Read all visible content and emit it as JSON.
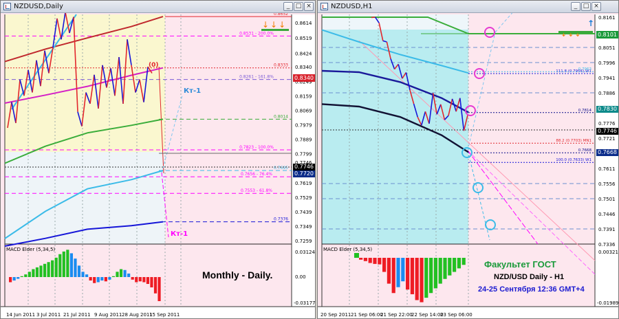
{
  "colors": {
    "mt_red": "#e2262c",
    "mt_blue": "#1515d8",
    "mt_green": "#3aad3a",
    "mt_cyan": "#3bbbe8",
    "mt_magenta": "#ff00ff"
  },
  "windows": [
    {
      "title": "NZDUSD,Daily",
      "buttons": [
        "_",
        "□",
        "×"
      ],
      "price_labels": [
        "0.8614",
        "0.8519",
        "0.8424",
        "0.8340",
        "0.8249",
        "0.8159",
        "0.8069",
        "0.7979",
        "0.7889",
        "0.7799",
        "0.7746",
        "0.7720",
        "0.7619",
        "0.7529",
        "0.7439",
        "0.7349",
        "0.7259"
      ],
      "current_price": "0.8340",
      "bid_box": "0.7746",
      "ask_box": "0.7720",
      "level_labels": [
        "0.8652",
        "0.8531 - 200.0%",
        "0.8333",
        "0.8261 - 161.8%",
        "0.8014",
        "0.7823 - 100.0%",
        "0.7695",
        "0.7656 - 76.4%",
        "0.7553 - 61.8%",
        "0.7376"
      ],
      "kt_labels": [
        "Кт-1",
        "Кт-1"
      ],
      "zero_marker": "(0)",
      "macd": {
        "title": "MACD Elder (5,34,5)",
        "labels": [
          "0.03124",
          "0.00",
          "-0.03177"
        ]
      },
      "time_labels": [
        "14 Jun 2011",
        "3 Jul 2011",
        "21 Jul 2011",
        "9 Aug 2011",
        "28 Aug 2011",
        "15 Sep 2011"
      ],
      "caption": "Monthly - Daily."
    },
    {
      "title": "NZDUSD,H1",
      "buttons": [
        "_",
        "□",
        "×"
      ],
      "price_labels": [
        "0.8161",
        "0.8101",
        "0.8051",
        "0.7996",
        "0.7941",
        "0.7886",
        "0.7830",
        "0.7776",
        "0.7746",
        "0.7721",
        "0.7668",
        "0.7611",
        "0.7556",
        "0.7501",
        "0.7446",
        "0.7391",
        "0.7336"
      ],
      "level_labels": [
        "111.8 (0.7956) W1",
        "0.7963",
        "0.7814",
        "88.2 (0.7703) MN1",
        "0.7668",
        "100.0 (0.7633) W1"
      ],
      "macd": {
        "title": "MACD Elder (5,34,5)",
        "labels": [
          "0.00321",
          "-0.01989"
        ]
      },
      "time_labels": [
        "20 Sep 2011",
        "21 Sep 06:00",
        "21 Sep 22:00",
        "22 Sep 14:00",
        "23 Sep 06:00"
      ],
      "caption_lines": [
        "Факультет ГОСТ",
        "NZD/USD Daily - H1",
        "24-25 Сентября 12:36 GMT+4"
      ]
    }
  ],
  "chart_data": [
    {
      "type": "line",
      "title": "NZDUSD,Daily",
      "series": [
        {
          "name": "",
          "values": [
            0.796,
            0.812,
            0.799,
            0.826,
            0.816,
            0.832,
            0.818,
            0.838,
            0.822,
            0.844,
            0.83,
            0.846,
            0.864,
            0.851,
            0.868,
            0.855,
            0.865,
            0.806,
            0.797,
            0.818,
            0.811,
            0.829,
            0.808,
            0.835,
            0.821,
            0.833,
            0.816,
            0.84,
            0.811,
            0.851,
            0.835,
            0.818,
            0.826,
            0.812,
            0.834,
            0.83
          ]
        },
        {
          "name": "",
          "values": [
            0.7225,
            0.7273,
            0.733,
            0.7352,
            0.7376
          ]
        },
        {
          "name": "",
          "values": [
            0.7272,
            0.7441,
            0.7581,
            0.7638,
            0.7695
          ]
        },
        {
          "name": "",
          "values": [
            0.774,
            0.7846,
            0.7929,
            0.7976,
            0.8014
          ]
        },
        {
          "name": "",
          "values": [
            0.8114,
            0.8164,
            0.8218,
            0.8287,
            0.8333
          ]
        },
        {
          "name": "",
          "values": [
            0.8372,
            0.845,
            0.8519,
            0.859,
            0.8652
          ]
        }
      ],
      "levels": [
        0.8652,
        0.8531,
        0.8333,
        0.8261,
        0.8014,
        0.7823,
        0.7695,
        0.7656,
        0.7553,
        0.7376
      ],
      "ylim": [
        0.7259,
        0.8614
      ],
      "macd_values": [
        -0.006,
        -0.004,
        -0.002,
        0.001,
        0.003,
        0.006,
        0.009,
        0.011,
        0.013,
        0.015,
        0.017,
        0.019,
        0.022,
        0.026,
        0.029,
        0.031,
        0.027,
        0.021,
        0.013,
        0.006,
        0.003,
        -0.004,
        -0.007,
        -0.006,
        -0.004,
        -0.005,
        -0.003,
        0.001,
        0.006,
        0.009,
        0.008,
        0.004,
        -0.003,
        -0.006,
        -0.005,
        -0.006,
        -0.008,
        -0.012,
        -0.019,
        -0.028
      ]
    },
    {
      "type": "line",
      "title": "NZDUSD,H1",
      "series": [
        {
          "name": "",
          "values": [
            0.816,
            0.8161,
            0.814,
            0.8075,
            0.8071,
            0.801,
            0.7972,
            0.799,
            0.7938,
            0.796,
            0.7896,
            0.7846,
            0.7798,
            0.7768,
            0.7818,
            0.7774,
            0.7885,
            0.7808,
            0.7844,
            0.7788,
            0.7803,
            0.7864,
            0.7818,
            0.7867,
            0.7748,
            0.7805
          ]
        }
      ],
      "levels": [
        0.7956,
        0.7963,
        0.7814,
        0.7703,
        0.7668,
        0.7633
      ],
      "ylim": [
        0.7336,
        0.8161
      ],
      "macd_values": [
        -0.0008,
        -0.0014,
        -0.0022,
        -0.0026,
        -0.0028,
        -0.006,
        -0.011,
        -0.015,
        -0.0125,
        -0.01,
        -0.0135,
        -0.0155,
        -0.018,
        -0.0189,
        -0.017,
        -0.015,
        -0.013,
        -0.011,
        -0.009,
        -0.0075,
        -0.006,
        -0.0045,
        -0.003
      ]
    }
  ]
}
